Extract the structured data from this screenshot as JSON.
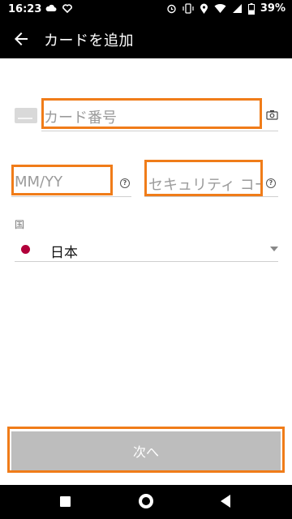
{
  "status_bar": {
    "time": "16:23",
    "battery": "39%",
    "icons": [
      "cloud-icon",
      "heart-pulse-icon",
      "alarm-icon",
      "vibrate-icon",
      "location-icon",
      "wifi-icon",
      "signal-icon",
      "battery-icon"
    ]
  },
  "app_bar": {
    "title": "カードを追加"
  },
  "form": {
    "card_number_placeholder": "カード番号",
    "expiry_placeholder": "MM/YY",
    "security_code_placeholder": "セキュリティ コード",
    "country_label": "国",
    "country_value": "日本"
  },
  "actions": {
    "next_label": "次へ"
  },
  "colors": {
    "highlight": "#f07c19",
    "flag": "#b1003a",
    "button_disabled": "#bdbdbd"
  }
}
